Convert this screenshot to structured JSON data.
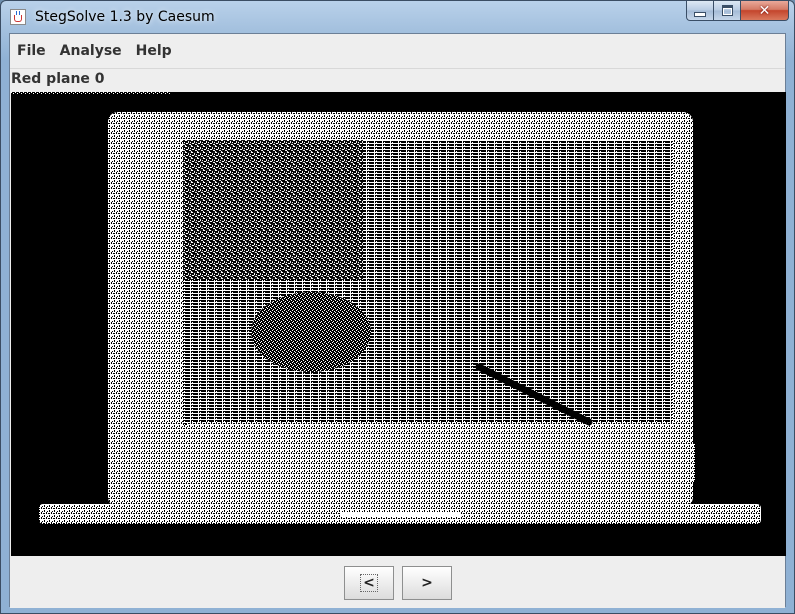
{
  "window": {
    "title": "StegSolve 1.3 by Caesum",
    "controls": {
      "minimize_icon": "minimize-icon",
      "maximize_icon": "maximize-icon",
      "close_label": "✕"
    }
  },
  "menu": {
    "items": [
      {
        "label": "File"
      },
      {
        "label": "Analyse"
      },
      {
        "label": "Help"
      }
    ]
  },
  "status": {
    "plane_label": "Red plane 0"
  },
  "image": {
    "description_icon": "bitplane-image",
    "background": "#000000",
    "foreground": "#ffffff"
  },
  "navigation": {
    "prev_label": "<",
    "next_label": ">"
  }
}
